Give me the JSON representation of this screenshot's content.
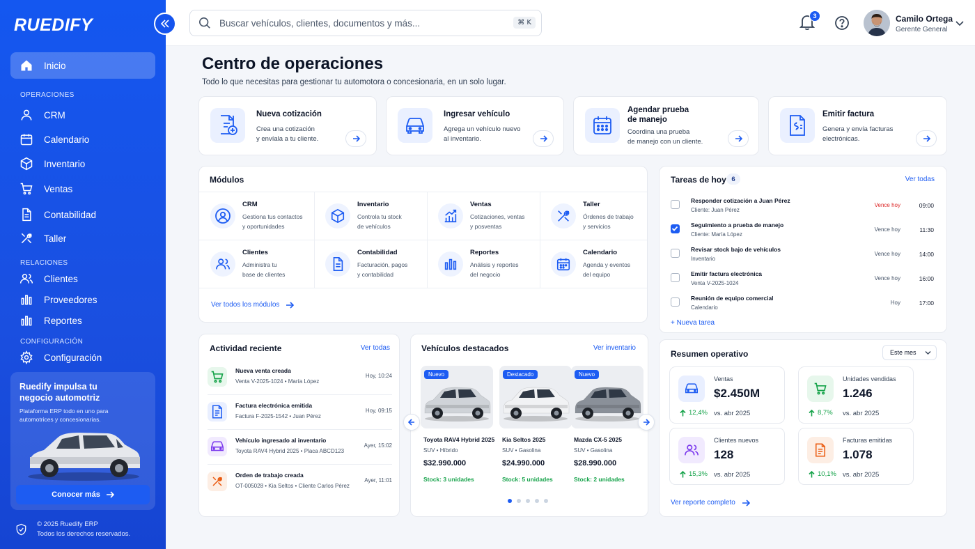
{
  "app": {
    "logo": "RUEDIFY"
  },
  "sidebar": {
    "home": "Inicio",
    "sections": {
      "operaciones": "OPERACIONES",
      "relaciones": "RELACIONES",
      "configuracion": "CONFIGURACIÓN"
    },
    "items": [
      {
        "label": "CRM",
        "icon": "user-icon"
      },
      {
        "label": "Calendario",
        "icon": "calendar-icon"
      },
      {
        "label": "Inventario",
        "icon": "box-icon"
      },
      {
        "label": "Ventas",
        "icon": "cart-icon"
      },
      {
        "label": "Contabilidad",
        "icon": "document-icon"
      },
      {
        "label": "Taller",
        "icon": "tools-icon"
      },
      {
        "label": "Clientes",
        "icon": "users-icon"
      },
      {
        "label": "Proveedores",
        "icon": "bars-icon"
      },
      {
        "label": "Reportes",
        "icon": "bars-icon"
      },
      {
        "label": "Configuración",
        "icon": "gear-icon"
      }
    ],
    "promo": {
      "title": "Ruedify impulsa tu negocio automotriz",
      "subtitle": "Plataforma ERP todo en uno para automotrices y concesionarias.",
      "button": "Conocer más"
    },
    "footer": {
      "line1": "© 2025 Ruedify ERP",
      "line2": "Todos los derechos reservados."
    }
  },
  "topbar": {
    "search_placeholder": "Buscar vehículos, clientes, documentos y más...",
    "shortcut": "⌘ K",
    "notifications": "3",
    "user": {
      "name": "Camilo Ortega",
      "role": "Gerente General"
    }
  },
  "page": {
    "title": "Centro de operaciones",
    "subtitle": "Todo lo que necesitas para gestionar tu automotora o concesionaria, en un solo lugar."
  },
  "quick_actions": [
    {
      "title": "Nueva cotización",
      "desc1": "Crea una cotización",
      "desc2": "y envíala a tu cliente.",
      "icon": "quote-icon"
    },
    {
      "title": "Ingresar vehículo",
      "desc1": "Agrega un vehículo nuevo",
      "desc2": "al inventario.",
      "icon": "car-icon"
    },
    {
      "title": "Agendar prueba",
      "title2": "de manejo",
      "desc1": "Coordina una prueba",
      "desc2": "de manejo con un cliente.",
      "icon": "calendar-icon"
    },
    {
      "title": "Emitir factura",
      "desc1": "Genera y envía facturas",
      "desc2": "electrónicas.",
      "icon": "invoice-icon"
    }
  ],
  "modules": {
    "title": "Módulos",
    "link": "Ver todos los módulos",
    "items": [
      {
        "title": "CRM",
        "desc1": "Gestiona tus contactos",
        "desc2": "y oportunidades"
      },
      {
        "title": "Inventario",
        "desc1": "Controla tu stock",
        "desc2": "de vehículos"
      },
      {
        "title": "Ventas",
        "desc1": "Cotizaciones, ventas",
        "desc2": "y posventas"
      },
      {
        "title": "Taller",
        "desc1": "Órdenes de trabajo",
        "desc2": "y servicios"
      },
      {
        "title": "Clientes",
        "desc1": "Administra tu",
        "desc2": "base de clientes"
      },
      {
        "title": "Contabilidad",
        "desc1": "Facturación, pagos",
        "desc2": "y contabilidad"
      },
      {
        "title": "Reportes",
        "desc1": "Análisis y reportes",
        "desc2": "del negocio"
      },
      {
        "title": "Calendario",
        "desc1": "Agenda y eventos",
        "desc2": "del equipo"
      }
    ]
  },
  "tasks": {
    "title": "Tareas de hoy",
    "count": "6",
    "link": "Ver todas",
    "add": "+ Nueva tarea",
    "items": [
      {
        "title": "Responder cotización a Juan Pérez",
        "sub": "Cliente: Juan Pérez",
        "due": "Vence hoy",
        "time": "09:00",
        "checked": false,
        "urgent": true
      },
      {
        "title": "Seguimiento a prueba de manejo",
        "sub": "Cliente: María López",
        "due": "Vence hoy",
        "time": "11:30",
        "checked": true,
        "urgent": false
      },
      {
        "title": "Revisar stock bajo de vehículos",
        "sub": "Inventario",
        "due": "Vence hoy",
        "time": "14:00",
        "checked": false,
        "urgent": false
      },
      {
        "title": "Emitir factura electrónica",
        "sub": "Venta V-2025-1024",
        "due": "Vence hoy",
        "time": "16:00",
        "checked": false,
        "urgent": false
      },
      {
        "title": "Reunión de equipo comercial",
        "sub": "Calendario",
        "due": "Hoy",
        "time": "17:00",
        "checked": false,
        "urgent": false
      }
    ]
  },
  "activity": {
    "title": "Actividad reciente",
    "link": "Ver todas",
    "items": [
      {
        "title": "Nueva venta creada",
        "sub": "Venta V-2025-1024  •  María López",
        "time": "Hoy, 10:24",
        "color": "#16a34a",
        "bg": "#e7f7ec",
        "icon": "cart-icon"
      },
      {
        "title": "Factura electrónica emitida",
        "sub": "Factura F-2025-1542  •  Juan Pérez",
        "time": "Hoy, 09:15",
        "color": "#1d5cf2",
        "bg": "#e9efff",
        "icon": "invoice-icon"
      },
      {
        "title": "Vehículo ingresado al inventario",
        "sub": "Toyota RAV4 Hybrid 2025  •  Placa ABCD123",
        "time": "Ayer, 15:02",
        "color": "#7c3aed",
        "bg": "#f1eafe",
        "icon": "car-icon"
      },
      {
        "title": "Orden de trabajo creada",
        "sub": "OT-005028  •  Kia Seltos  •  Cliente Carlos Pérez",
        "time": "Ayer, 11:01",
        "color": "#ea580c",
        "bg": "#fdeee4",
        "icon": "tools-icon"
      }
    ]
  },
  "vehicles": {
    "title": "Vehículos destacados",
    "link": "Ver inventario",
    "items": [
      {
        "tag": "Nuevo",
        "name": "Toyota RAV4 Hybrid 2025",
        "sub": "SUV  •  Híbrido",
        "price": "$32.990.000",
        "stock": "Stock: 3 unidades",
        "color": "#cfd3d8"
      },
      {
        "tag": "Destacado",
        "name": "Kia Seltos 2025",
        "sub": "SUV  •  Gasolina",
        "price": "$24.990.000",
        "stock": "Stock: 5 unidades",
        "color": "#f1f2f4"
      },
      {
        "tag": "Nuevo",
        "name": "Mazda CX-5 2025",
        "sub": "SUV  •  Gasolina",
        "price": "$28.990.000",
        "stock": "Stock: 2 unidades",
        "color": "#8a9099"
      }
    ],
    "pages": 5,
    "active_page": 1
  },
  "summary": {
    "title": "Resumen operativo",
    "period": "Este mes",
    "link": "Ver reporte completo",
    "stats": [
      {
        "label": "Ventas",
        "value": "$2.450M",
        "delta": "12,4%",
        "cmp": "vs. abr 2025",
        "color": "#1d5cf2",
        "bg": "#e9efff",
        "icon": "car-icon"
      },
      {
        "label": "Unidades vendidas",
        "value": "1.246",
        "delta": "8,7%",
        "cmp": "vs. abr 2025",
        "color": "#16a34a",
        "bg": "#e7f7ec",
        "icon": "cart-icon"
      },
      {
        "label": "Clientes nuevos",
        "value": "128",
        "delta": "15,3%",
        "cmp": "vs. abr 2025",
        "color": "#7c3aed",
        "bg": "#f1eafe",
        "icon": "users-icon"
      },
      {
        "label": "Facturas emitidas",
        "value": "1.078",
        "delta": "10,1%",
        "cmp": "vs. abr 2025",
        "color": "#ea580c",
        "bg": "#fdeee4",
        "icon": "invoice-icon"
      }
    ]
  },
  "colors": {
    "accent": "#1d5cf2",
    "sidebar": "#1457f0",
    "success": "#16a34a",
    "danger": "#dc2626"
  }
}
